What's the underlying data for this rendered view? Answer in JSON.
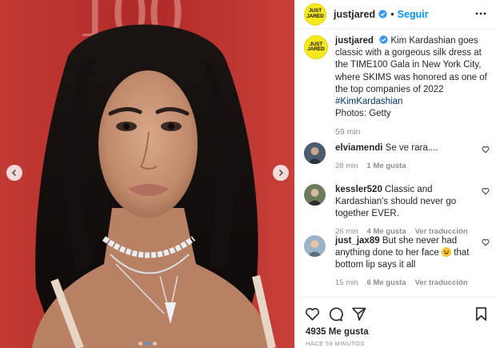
{
  "post": {
    "username": "justjared",
    "follow_label": "Seguir",
    "separator": "•",
    "logo_text": "JUST JARED"
  },
  "caption": {
    "username": "justjared",
    "text": "Kim Kardashian goes classic with a gorgeous silk dress at the TIME100 Gala in New York City, where SKIMS was honored as one of the top companies of 2022",
    "hashtag": "#KimKardashian",
    "photos": "Photos: Getty",
    "time": "59 min"
  },
  "comments": [
    {
      "username": "elviamendi",
      "text": "Se ve rara....",
      "time": "28 min",
      "likes": "1 Me gusta",
      "translate": ""
    },
    {
      "username": "kessler520",
      "text": "Classic and Kardashian's should never go together EVER.",
      "time": "26 min",
      "likes": "4 Me gusta",
      "translate": "Ver traducción"
    },
    {
      "username": "just_jax89",
      "text_before": "But she never had anything done to her face",
      "text_after": "that bottom lip says it all",
      "emoji": "laughing-emoji",
      "time": "15 min",
      "likes": "6 Me gusta",
      "translate": "Ver traducción"
    }
  ],
  "footer": {
    "likes": "4935 Me gusta",
    "ago": "HACE 59 MINUTOS"
  },
  "icons": {
    "verified": "verified-badge-icon",
    "more": "more-options-icon",
    "like": "heart-icon",
    "comment": "comment-bubble-icon",
    "share": "paper-plane-icon",
    "save": "bookmark-icon",
    "prev": "chevron-left-icon",
    "next": "chevron-right-icon"
  },
  "colors": {
    "brand_yellow": "#f5e81c",
    "link_blue": "#0095f6",
    "hashtag": "#00376b",
    "muted": "#8e8e8e",
    "backdrop_red": "#c0312f"
  }
}
